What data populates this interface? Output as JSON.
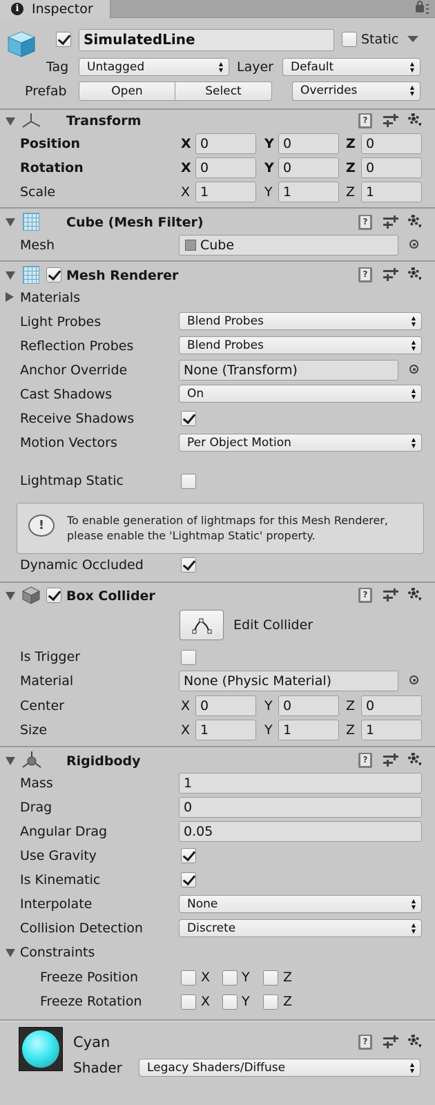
{
  "tab": {
    "title": "Inspector"
  },
  "object": {
    "name": "SimulatedLine",
    "active": true,
    "static_label": "Static",
    "static_checked": false,
    "tag_label": "Tag",
    "tag_value": "Untagged",
    "layer_label": "Layer",
    "layer_value": "Default",
    "prefab_label": "Prefab",
    "open_label": "Open",
    "select_label": "Select",
    "overrides_label": "Overrides"
  },
  "transform": {
    "title": "Transform",
    "rows": [
      {
        "label": "Position",
        "x": "0",
        "y": "0",
        "z": "0"
      },
      {
        "label": "Rotation",
        "x": "0",
        "y": "0",
        "z": "0"
      },
      {
        "label": "Scale",
        "x": "1",
        "y": "1",
        "z": "1"
      }
    ]
  },
  "axes": {
    "x": "X",
    "y": "Y",
    "z": "Z"
  },
  "mesh_filter": {
    "title": "Cube (Mesh Filter)",
    "mesh_label": "Mesh",
    "mesh_value": "Cube"
  },
  "mesh_renderer": {
    "title": "Mesh Renderer",
    "enabled": true,
    "materials_label": "Materials",
    "light_probes_label": "Light Probes",
    "light_probes_value": "Blend Probes",
    "reflection_probes_label": "Reflection Probes",
    "reflection_probes_value": "Blend Probes",
    "anchor_override_label": "Anchor Override",
    "anchor_override_value": "None (Transform)",
    "cast_shadows_label": "Cast Shadows",
    "cast_shadows_value": "On",
    "receive_shadows_label": "Receive Shadows",
    "receive_shadows": true,
    "motion_vectors_label": "Motion Vectors",
    "motion_vectors_value": "Per Object Motion",
    "lightmap_static_label": "Lightmap Static",
    "lightmap_static": false,
    "help_line1": "To enable generation of lightmaps for this Mesh Renderer,",
    "help_line2": "please enable the 'Lightmap Static' property.",
    "dynamic_occluded_label": "Dynamic Occluded",
    "dynamic_occluded": true
  },
  "box_collider": {
    "title": "Box Collider",
    "enabled": true,
    "edit_label": "Edit Collider",
    "is_trigger_label": "Is Trigger",
    "is_trigger": false,
    "material_label": "Material",
    "material_value": "None (Physic Material)",
    "center_label": "Center",
    "center": {
      "x": "0",
      "y": "0",
      "z": "0"
    },
    "size_label": "Size",
    "size": {
      "x": "1",
      "y": "1",
      "z": "1"
    }
  },
  "rigidbody": {
    "title": "Rigidbody",
    "mass_label": "Mass",
    "mass": "1",
    "drag_label": "Drag",
    "drag": "0",
    "angular_drag_label": "Angular Drag",
    "angular_drag": "0.05",
    "use_gravity_label": "Use Gravity",
    "use_gravity": true,
    "is_kinematic_label": "Is Kinematic",
    "is_kinematic": true,
    "interpolate_label": "Interpolate",
    "interpolate_value": "None",
    "collision_label": "Collision Detection",
    "collision_value": "Discrete",
    "constraints_label": "Constraints",
    "freeze_position_label": "Freeze Position",
    "freeze_rotation_label": "Freeze Rotation"
  },
  "material": {
    "name": "Cyan",
    "shader_label": "Shader",
    "shader_value": "Legacy Shaders/Diffuse",
    "color": "#3ee8f2"
  }
}
